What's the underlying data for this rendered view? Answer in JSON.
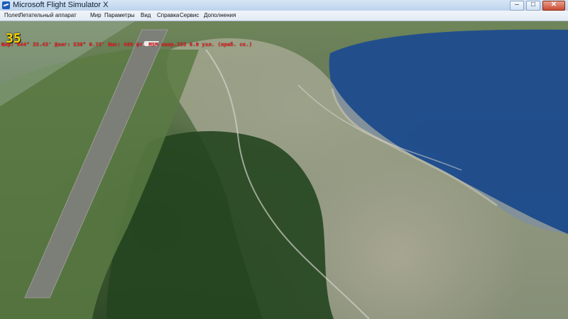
{
  "window": {
    "title": "Microsoft Flight Simulator X",
    "controls": {
      "minimize_icon": "minimize-icon",
      "maximize_icon": "maximize-icon",
      "close_icon": "close-icon"
    }
  },
  "menu": {
    "items": [
      {
        "label": "Полет"
      },
      {
        "label": "Летательный аппарат"
      },
      {
        "label": "Мир"
      },
      {
        "label": "Параметры"
      },
      {
        "label": "Вид"
      },
      {
        "label": "Справка"
      },
      {
        "label": "Сервис"
      },
      {
        "label": "Дополнения"
      }
    ]
  },
  "hud": {
    "counter": "35",
    "status_line": "Шир: N44° 33.43'  Долг: E38° 0.72'  Выс: 469 фт. MSM  напр.293  0.0 узл. (приб. ск.)"
  },
  "colors": {
    "hud_text": "#ff2b2b",
    "counter_text": "#ffd800",
    "sea": "#1f4c8f",
    "runway": "#7e7e7b"
  }
}
